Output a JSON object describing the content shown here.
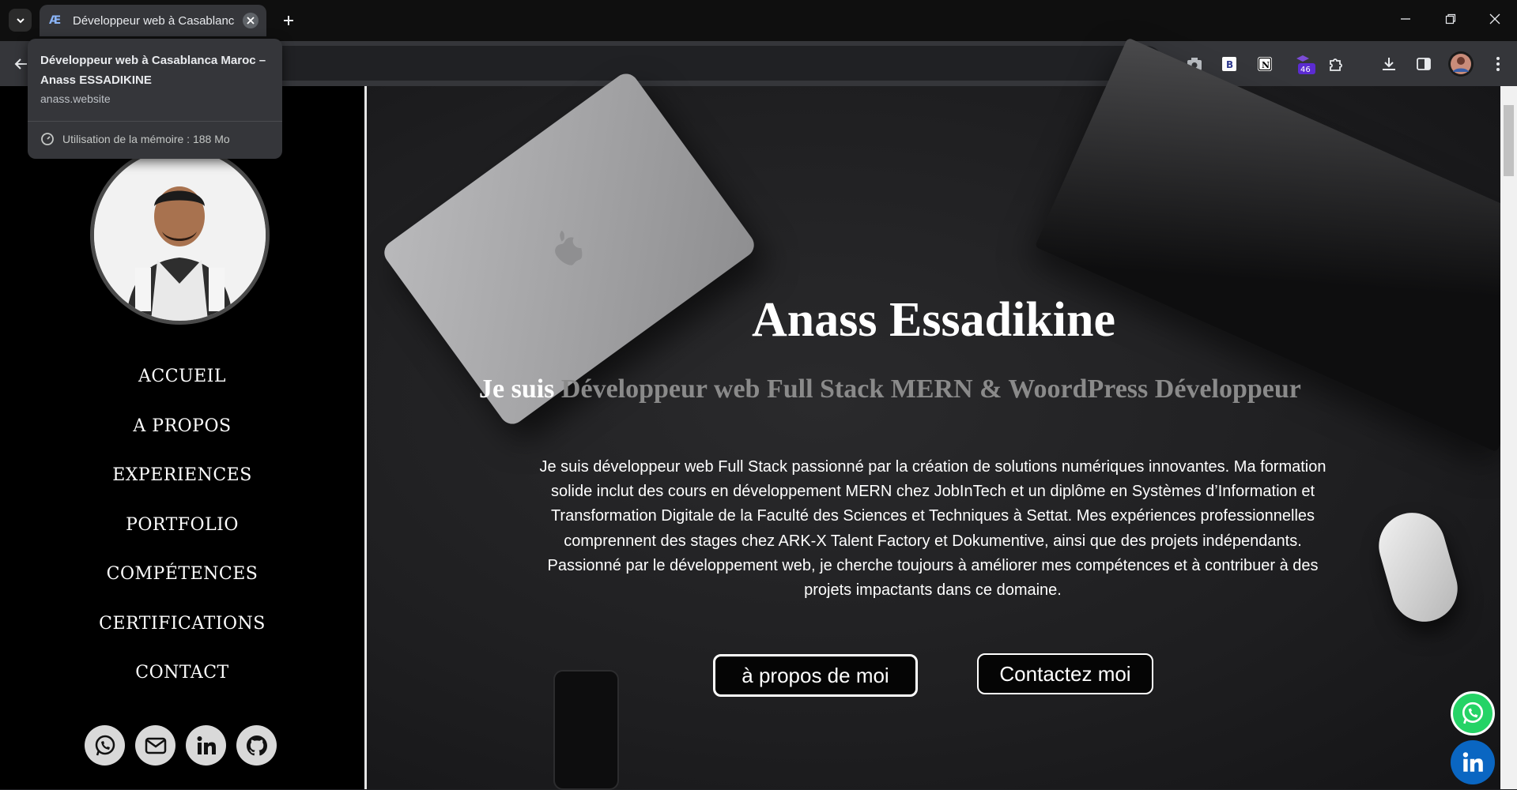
{
  "browser": {
    "tab_title": "Développeur web à Casablanca Maroc – Anass ESSADIKINE",
    "tab_favicon": "Æ",
    "toolbar_icons": [
      "back-arrow-icon",
      "star-icon",
      "camera-icon",
      "b-extension-icon",
      "notion-icon",
      "extension-badge-icon",
      "puzzle-icon",
      "download-icon",
      "sidepanel-icon",
      "profile-avatar",
      "kebab-menu-icon"
    ],
    "extension_badge": "46"
  },
  "hover_card": {
    "title": "Développeur web à Casablanca Maroc – Anass ESSADIKINE",
    "url": "anass.website",
    "memory": "Utilisation de la mémoire : 188 Mo"
  },
  "sidebar": {
    "nav": [
      "ACCUEIL",
      "A PROPOS",
      "EXPERIENCES",
      "PORTFOLIO",
      "COMPÉTENCES",
      "CERTIFICATIONS",
      "CONTACT"
    ],
    "socials": [
      "whatsapp-icon",
      "mail-icon",
      "linkedin-icon",
      "github-icon"
    ]
  },
  "hero": {
    "name": "Anass Essadikine",
    "role_prefix": "Je suis",
    "role_text": " Développeur web Full Stack MERN & WoordPress Développeur",
    "bio": "Je suis développeur web Full Stack passionné par la création de solutions numériques innovantes. Ma formation solide inclut des cours en développement MERN chez JobInTech et un diplôme en Systèmes d’Information et Transformation Digitale de la Faculté des Sciences et Techniques à Settat. Mes expériences professionnelles comprennent des stages chez ARK-X Talent Factory et Dokumentive, ainsi que des projets indépendants. Passionné par le développement web, je cherche toujours à améliorer mes compétences et à contribuer à des projets impactants dans ce domaine.",
    "button_about": "à propos de moi",
    "button_contact": "Contactez moi"
  },
  "colors": {
    "accent_whatsapp": "#25d366",
    "accent_linkedin": "#0a66c2"
  }
}
